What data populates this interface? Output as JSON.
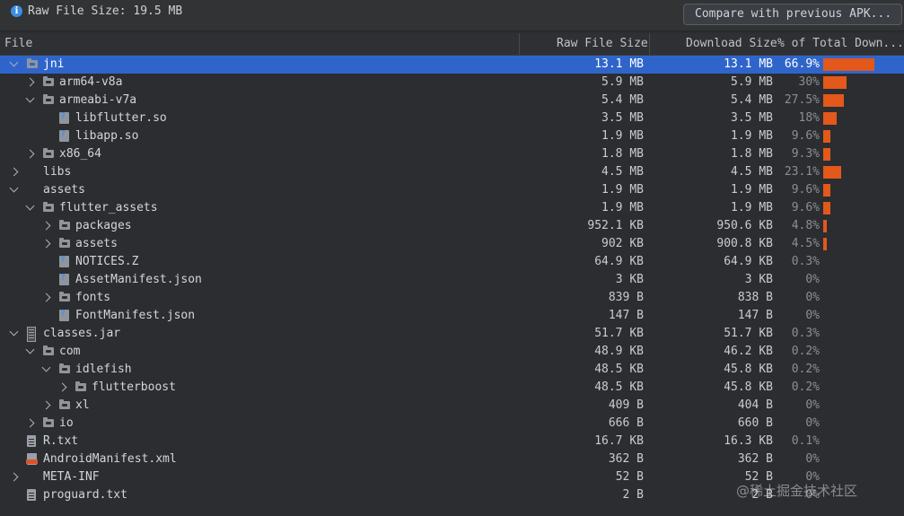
{
  "toolbar": {
    "info_icon": "info-icon",
    "raw_file_size": "Raw File Size: 19.5 MB",
    "compare_button": "Compare with previous APK..."
  },
  "columns": {
    "file": "File",
    "raw": "Raw File Size",
    "download": "Download Size",
    "percent": "% of Total Down..."
  },
  "colors": {
    "selection": "#2f65ca",
    "bar": "#e3581b",
    "background": "#2b2d30"
  },
  "rows": [
    {
      "name": "jni",
      "raw": "13.1 MB",
      "dl": "13.1 MB",
      "pct": "66.9%",
      "share": 0.669,
      "icon": "folder-icon",
      "arrow": "expanded",
      "selected": true
    },
    {
      "name": "arm64-v8a",
      "raw": "5.9 MB",
      "dl": "5.9 MB",
      "pct": "30%",
      "share": 0.3,
      "icon": "folder-icon",
      "arrow": "collapsed"
    },
    {
      "name": "armeabi-v7a",
      "raw": "5.4 MB",
      "dl": "5.4 MB",
      "pct": "27.5%",
      "share": 0.275,
      "icon": "folder-icon",
      "arrow": "expanded"
    },
    {
      "name": "libflutter.so",
      "raw": "3.5 MB",
      "dl": "3.5 MB",
      "pct": "18%",
      "share": 0.18,
      "icon": "so-file-icon",
      "arrow": "none"
    },
    {
      "name": "libapp.so",
      "raw": "1.9 MB",
      "dl": "1.9 MB",
      "pct": "9.6%",
      "share": 0.096,
      "icon": "so-file-icon",
      "arrow": "none"
    },
    {
      "name": "x86_64",
      "raw": "1.8 MB",
      "dl": "1.8 MB",
      "pct": "9.3%",
      "share": 0.093,
      "icon": "folder-icon",
      "arrow": "collapsed"
    },
    {
      "name": "libs",
      "raw": "4.5 MB",
      "dl": "4.5 MB",
      "pct": "23.1%",
      "share": 0.231,
      "icon": "none",
      "arrow": "collapsed"
    },
    {
      "name": "assets",
      "raw": "1.9 MB",
      "dl": "1.9 MB",
      "pct": "9.6%",
      "share": 0.096,
      "icon": "none",
      "arrow": "expanded"
    },
    {
      "name": "flutter_assets",
      "raw": "1.9 MB",
      "dl": "1.9 MB",
      "pct": "9.6%",
      "share": 0.096,
      "icon": "folder-icon",
      "arrow": "expanded"
    },
    {
      "name": "packages",
      "raw": "952.1 KB",
      "dl": "950.6 KB",
      "pct": "4.8%",
      "share": 0.048,
      "icon": "folder-icon",
      "arrow": "collapsed"
    },
    {
      "name": "assets",
      "raw": "902 KB",
      "dl": "900.8 KB",
      "pct": "4.5%",
      "share": 0.045,
      "icon": "folder-icon",
      "arrow": "collapsed"
    },
    {
      "name": "NOTICES.Z",
      "raw": "64.9 KB",
      "dl": "64.9 KB",
      "pct": "0.3%",
      "share": 0.003,
      "icon": "so-file-icon",
      "arrow": "none"
    },
    {
      "name": "AssetManifest.json",
      "raw": "3 KB",
      "dl": "3 KB",
      "pct": "0%",
      "share": 0,
      "icon": "so-file-icon",
      "arrow": "none"
    },
    {
      "name": "fonts",
      "raw": "839 B",
      "dl": "838 B",
      "pct": "0%",
      "share": 0,
      "icon": "folder-icon",
      "arrow": "collapsed"
    },
    {
      "name": "FontManifest.json",
      "raw": "147 B",
      "dl": "147 B",
      "pct": "0%",
      "share": 0,
      "icon": "so-file-icon",
      "arrow": "none"
    },
    {
      "name": "classes.jar",
      "raw": "51.7 KB",
      "dl": "51.7 KB",
      "pct": "0.3%",
      "share": 0.003,
      "icon": "jar-icon",
      "arrow": "expanded"
    },
    {
      "name": "com",
      "raw": "48.9 KB",
      "dl": "46.2 KB",
      "pct": "0.2%",
      "share": 0.002,
      "icon": "folder-icon",
      "arrow": "expanded"
    },
    {
      "name": "idlefish",
      "raw": "48.5 KB",
      "dl": "45.8 KB",
      "pct": "0.2%",
      "share": 0.002,
      "icon": "folder-icon",
      "arrow": "expanded"
    },
    {
      "name": "flutterboost",
      "raw": "48.5 KB",
      "dl": "45.8 KB",
      "pct": "0.2%",
      "share": 0.002,
      "icon": "folder-icon",
      "arrow": "collapsed"
    },
    {
      "name": "xl",
      "raw": "409 B",
      "dl": "404 B",
      "pct": "0%",
      "share": 0,
      "icon": "folder-icon",
      "arrow": "collapsed"
    },
    {
      "name": "io",
      "raw": "666 B",
      "dl": "660 B",
      "pct": "0%",
      "share": 0,
      "icon": "folder-icon",
      "arrow": "collapsed"
    },
    {
      "name": "R.txt",
      "raw": "16.7 KB",
      "dl": "16.3 KB",
      "pct": "0.1%",
      "share": 0.001,
      "icon": "text-file-icon",
      "arrow": "none"
    },
    {
      "name": "AndroidManifest.xml",
      "raw": "362 B",
      "dl": "362 B",
      "pct": "0%",
      "share": 0,
      "icon": "xml-file-icon",
      "arrow": "none"
    },
    {
      "name": "META-INF",
      "raw": "52 B",
      "dl": "52 B",
      "pct": "0%",
      "share": 0,
      "icon": "none",
      "arrow": "collapsed"
    },
    {
      "name": "proguard.txt",
      "raw": "2 B",
      "dl": "2 B",
      "pct": "0%",
      "share": 0,
      "icon": "text-file-icon",
      "arrow": "none"
    }
  ],
  "watermark": "@稀土掘金技术社区"
}
